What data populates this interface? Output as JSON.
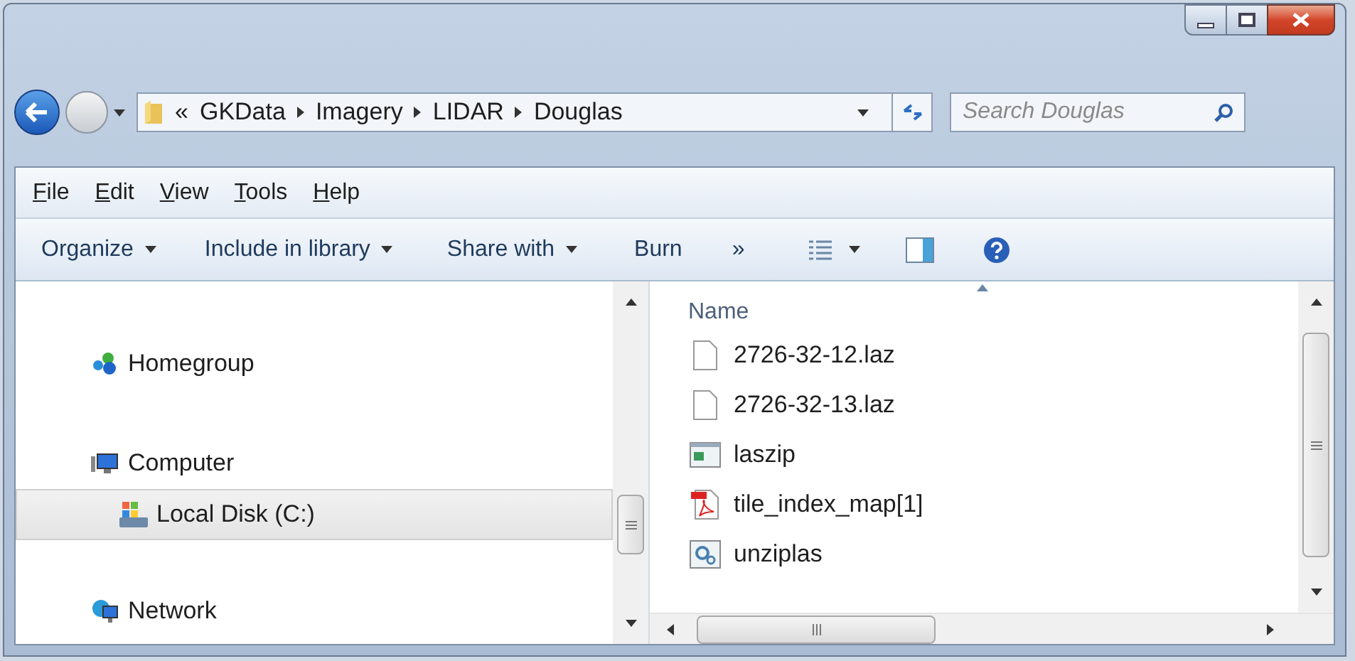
{
  "address": {
    "overflow": "«",
    "crumbs": [
      "GKData",
      "Imagery",
      "LIDAR",
      "Douglas"
    ]
  },
  "search": {
    "placeholder": "Search Douglas"
  },
  "menu": [
    "File",
    "Edit",
    "View",
    "Tools",
    "Help"
  ],
  "toolbar": [
    {
      "label": "Organize",
      "dropdown": true
    },
    {
      "label": "Include in library",
      "dropdown": true
    },
    {
      "label": "Share with",
      "dropdown": true
    },
    {
      "label": "Burn",
      "dropdown": false
    },
    {
      "label": "»",
      "dropdown": false
    }
  ],
  "nav": [
    {
      "label": "Homegroup",
      "kind": "homegroup",
      "selected": false
    },
    {
      "label": "Computer",
      "kind": "computer",
      "selected": false,
      "children": [
        {
          "label": "Local Disk (C:)",
          "kind": "disk",
          "selected": true
        }
      ]
    },
    {
      "label": "Network",
      "kind": "network",
      "selected": false
    }
  ],
  "files": {
    "column": "Name",
    "items": [
      {
        "name": "2726-32-12.laz",
        "kind": "blank"
      },
      {
        "name": "2726-32-13.laz",
        "kind": "blank"
      },
      {
        "name": "laszip",
        "kind": "app"
      },
      {
        "name": "tile_index_map[1]",
        "kind": "pdf"
      },
      {
        "name": "unziplas",
        "kind": "config"
      }
    ]
  }
}
